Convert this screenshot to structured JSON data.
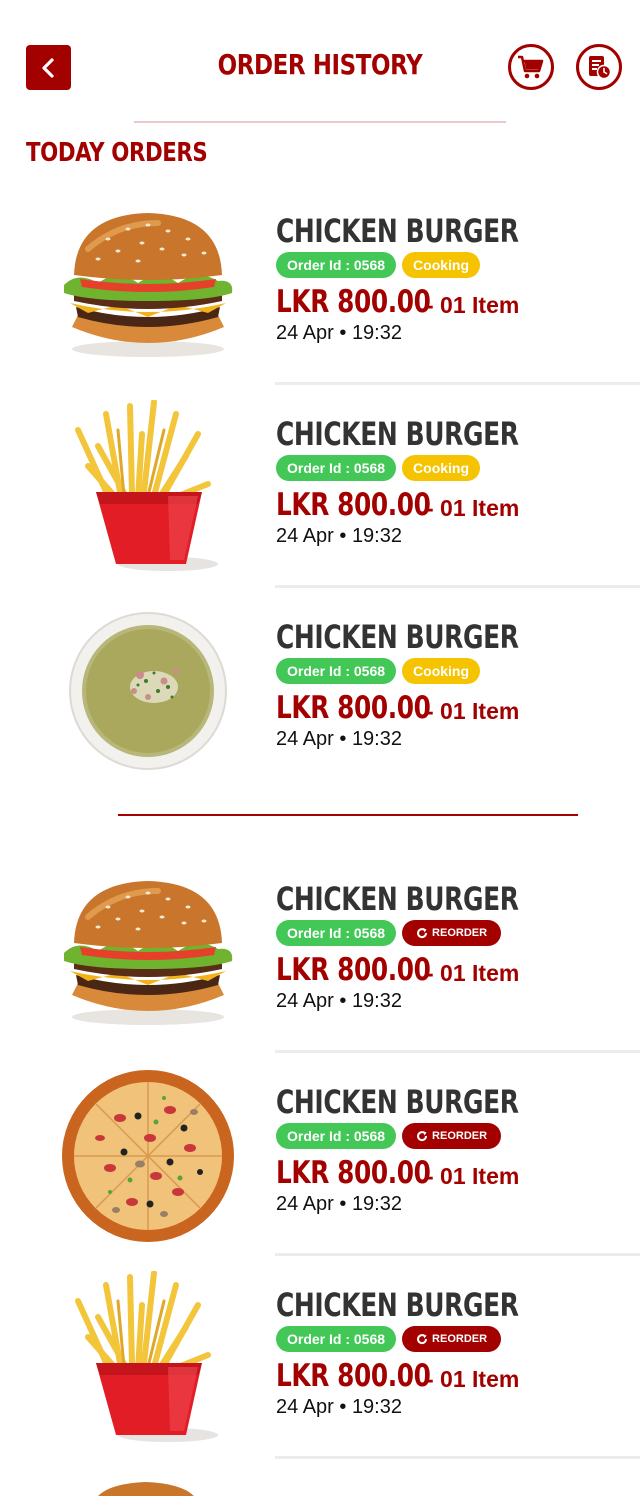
{
  "header": {
    "title": "ORDER HISTORY"
  },
  "section": {
    "today_title": "TODAY ORDERS"
  },
  "orders": [
    {
      "name": "CHICKEN BURGER",
      "order_id": "Order Id : 0568",
      "status": "Cooking",
      "price": "LKR 800.00",
      "items": " - 01 Item",
      "time": "24 Apr • 19:32",
      "image": "burger"
    },
    {
      "name": "CHICKEN BURGER",
      "order_id": "Order Id : 0568",
      "status": "Cooking",
      "price": "LKR 800.00",
      "items": " - 01 Item",
      "time": "24 Apr • 19:32",
      "image": "fries"
    },
    {
      "name": "CHICKEN BURGER",
      "order_id": "Order Id : 0568",
      "status": "Cooking",
      "price": "LKR 800.00",
      "items": " - 01 Item",
      "time": "24 Apr • 19:32",
      "image": "soup"
    },
    {
      "name": "CHICKEN BURGER",
      "order_id": "Order Id : 0568",
      "reorder": "REORDER",
      "price": "LKR 800.00",
      "items": " - 01 Item",
      "time": "24 Apr • 19:32",
      "image": "burger"
    },
    {
      "name": "CHICKEN BURGER",
      "order_id": "Order Id : 0568",
      "reorder": "REORDER",
      "price": "LKR 800.00",
      "items": " - 01 Item",
      "time": "24 Apr • 19:32",
      "image": "pizza"
    },
    {
      "name": "CHICKEN BURGER",
      "order_id": "Order Id : 0568",
      "reorder": "REORDER",
      "price": "LKR 800.00",
      "items": " - 01 Item",
      "time": "24 Apr • 19:32",
      "image": "fries"
    }
  ],
  "colors": {
    "brand": "#a30000",
    "id_badge": "#43c858",
    "cooking_badge": "#f6c300"
  },
  "icons": {
    "back": "chevron-left-icon",
    "cart": "cart-icon",
    "history": "receipt-clock-icon",
    "reorder": "refresh-icon"
  }
}
